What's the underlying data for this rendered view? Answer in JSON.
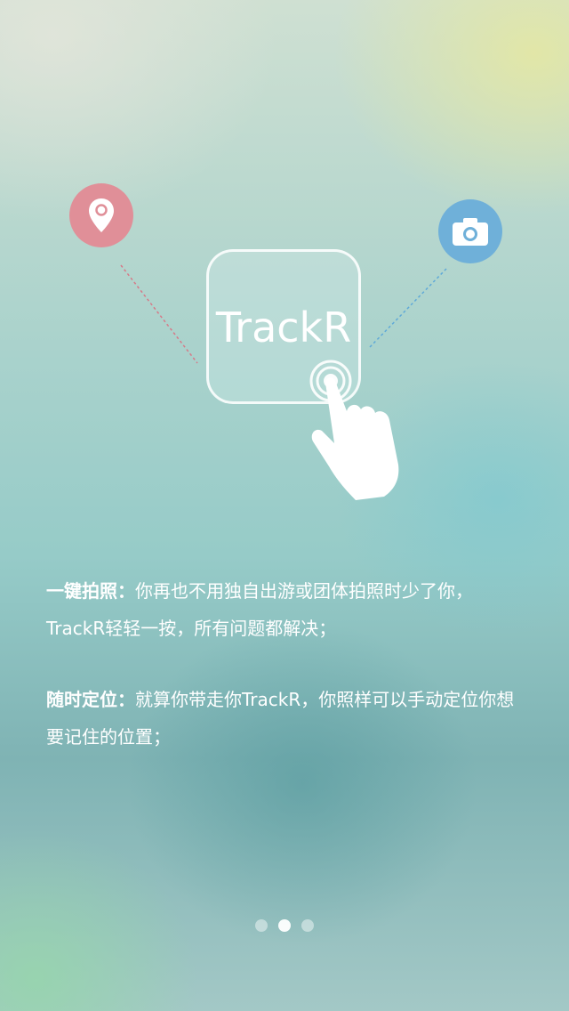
{
  "app": {
    "logo_text": "TrackR"
  },
  "features": [
    {
      "term": "一键拍照：",
      "description": "你再也不用独自出游或团体拍照时少了你，TrackR轻轻一按，所有问题都解决；"
    },
    {
      "term": "随时定位：",
      "description": "就算你带走你TrackR，你照样可以手动定位你想要记住的位置；"
    }
  ],
  "pager": {
    "total": 3,
    "active_index": 1
  },
  "icons": {
    "left": "location-pin-icon",
    "right": "camera-icon",
    "center": "tap-hand-icon"
  },
  "colors": {
    "pin_circle": "#e08f98",
    "camera_circle": "#6fb0d9",
    "dash_left": "#d67a88",
    "dash_right": "#5fa9d8"
  }
}
